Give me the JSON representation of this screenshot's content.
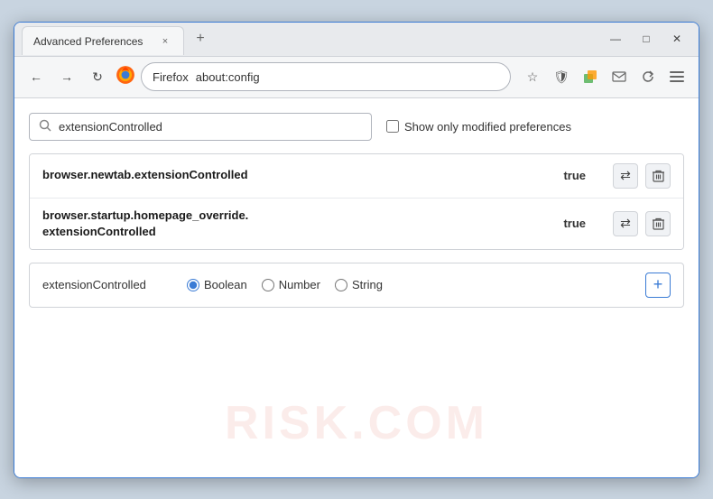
{
  "titleBar": {
    "tab": {
      "title": "Advanced Preferences",
      "closeLabel": "×"
    },
    "newTabLabel": "+",
    "windowControls": {
      "minimize": "—",
      "maximize": "□",
      "close": "✕"
    }
  },
  "navBar": {
    "backBtn": "←",
    "forwardBtn": "→",
    "reloadBtn": "↻",
    "firefoxLabel": "Firefox",
    "url": "about:config",
    "toolbarIcons": [
      "☆",
      "🛡",
      "🧩",
      "✉",
      "↻",
      "☰"
    ]
  },
  "searchBar": {
    "placeholder": "extensionControlled",
    "value": "extensionControlled",
    "showModifiedLabel": "Show only modified preferences"
  },
  "prefsTable": {
    "rows": [
      {
        "name": "browser.newtab.extensionControlled",
        "value": "true"
      },
      {
        "name": "browser.startup.homepage_override.\nextensionControlled",
        "nameLine1": "browser.startup.homepage_override.",
        "nameLine2": "extensionControlled",
        "value": "true",
        "multiline": true
      }
    ]
  },
  "addPrefRow": {
    "name": "extensionControlled",
    "radioOptions": [
      {
        "label": "Boolean",
        "value": "boolean",
        "checked": true
      },
      {
        "label": "Number",
        "value": "number",
        "checked": false
      },
      {
        "label": "String",
        "value": "string",
        "checked": false
      }
    ],
    "addLabel": "+"
  },
  "watermark": {
    "text": "RISK.COM"
  },
  "icons": {
    "search": "🔍",
    "swap": "⇄",
    "trash": "🗑"
  }
}
